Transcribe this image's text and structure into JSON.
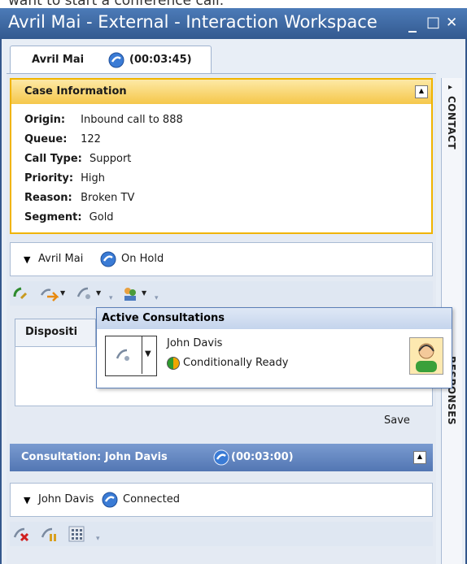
{
  "caption": "want to start a conference call.",
  "window": {
    "title": "Avril Mai - External - Interaction Workspace",
    "minimize": "_",
    "maximize": "□",
    "close": "✕"
  },
  "tab": {
    "label": "Avril Mai",
    "time": "(00:03:45)"
  },
  "case": {
    "title": "Case Information",
    "rows": [
      {
        "key": "Origin:",
        "value": "Inbound call to 888"
      },
      {
        "key": "Queue:",
        "value": "122"
      },
      {
        "key": "Call Type:",
        "value": "Support"
      },
      {
        "key": "Priority:",
        "value": "High"
      },
      {
        "key": "Reason:",
        "value": "Broken TV"
      },
      {
        "key": "Segment:",
        "value": "Gold"
      }
    ]
  },
  "party1": {
    "name": "Avril Mai",
    "status": "On Hold"
  },
  "disposition": {
    "tab_label": "Dispositi",
    "save_label": "Save"
  },
  "consultation": {
    "title": "Consultation: John Davis",
    "time": "(00:03:00)"
  },
  "party2": {
    "name": "John Davis",
    "status": "Connected"
  },
  "side": {
    "contact": "CONTACT",
    "responses": "RESPONSES"
  },
  "popup": {
    "title": "Active Consultations",
    "name": "John Davis",
    "status": "Conditionally Ready"
  },
  "colors": {
    "accent": "#f0b400",
    "title_bar": "#3f6aa6",
    "consult_header": "#5b7fb7"
  }
}
